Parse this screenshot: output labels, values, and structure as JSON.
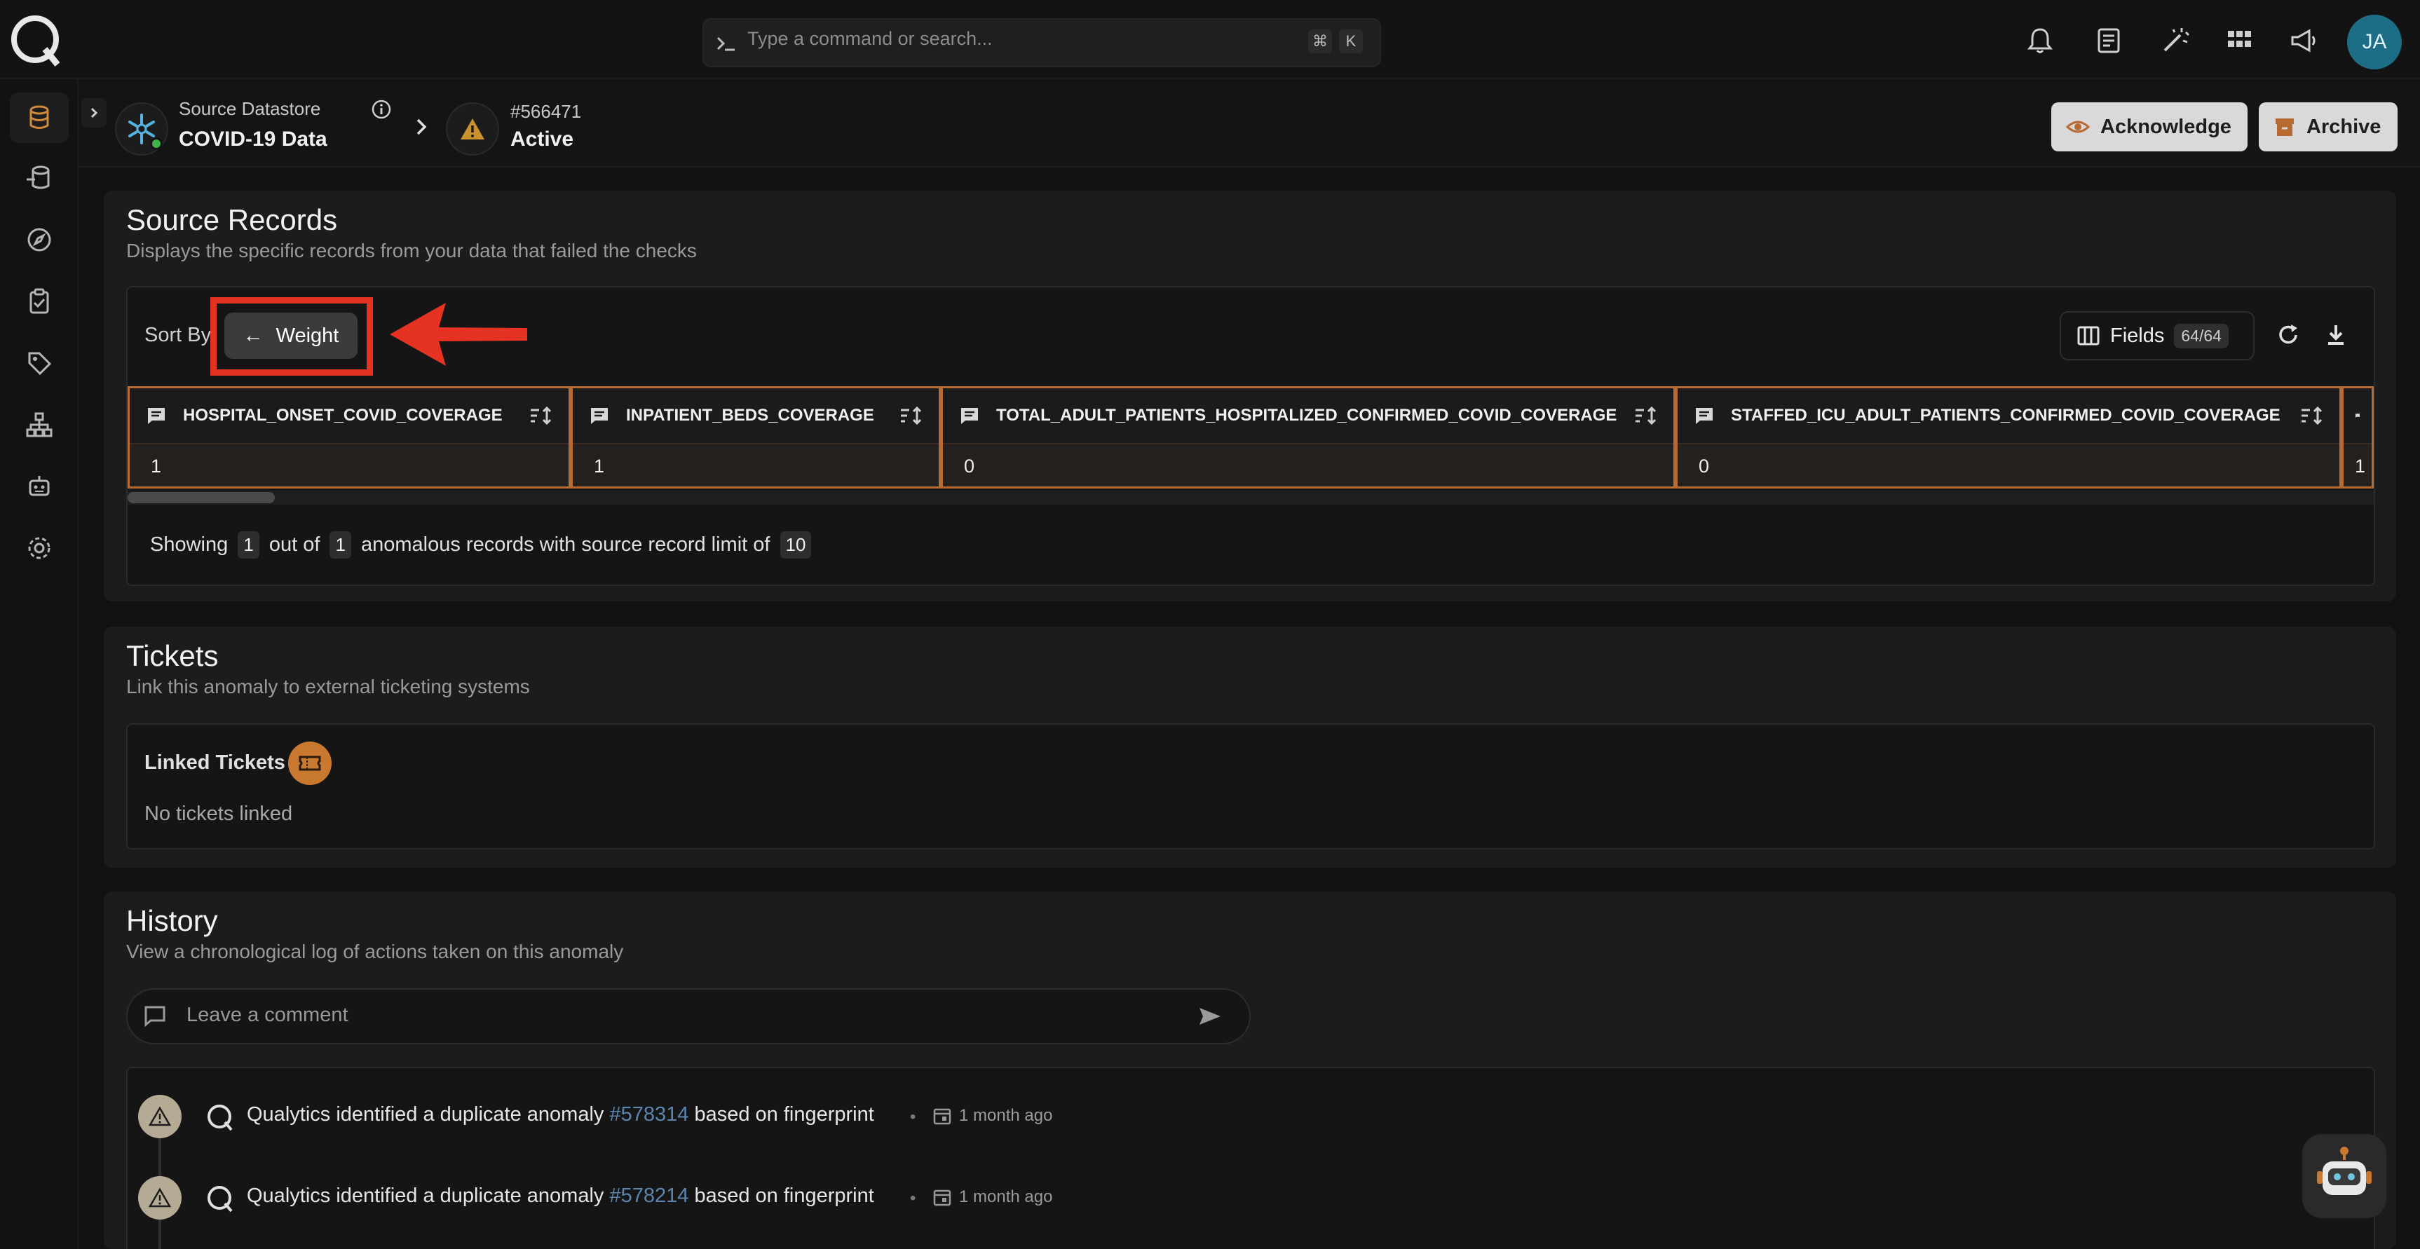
{
  "search": {
    "placeholder": "Type a command or search...",
    "kbd_cmd": "⌘",
    "kbd_key": "K"
  },
  "user": {
    "initials": "JA"
  },
  "breadcrumb": {
    "datastore_label": "Source Datastore",
    "datastore_name": "COVID-19 Data",
    "anomaly_id": "#566471",
    "anomaly_status": "Active"
  },
  "actions": {
    "acknowledge": "Acknowledge",
    "archive": "Archive"
  },
  "source_records": {
    "title": "Source Records",
    "subtitle": "Displays the specific records from your data that failed the checks",
    "sort_label": "Sort By",
    "sort_arrow": "←",
    "sort_value": "Weight",
    "fields_label": "Fields",
    "fields_count": "64/64",
    "columns": [
      {
        "name": "HOSPITAL_ONSET_COVID_COVERAGE",
        "value": "1"
      },
      {
        "name": "INPATIENT_BEDS_COVERAGE",
        "value": "1"
      },
      {
        "name": "TOTAL_ADULT_PATIENTS_HOSPITALIZED_CONFIRMED_COVID_COVERAGE",
        "value": "0"
      },
      {
        "name": "STAFFED_ICU_ADULT_PATIENTS_CONFIRMED_COVID_COVERAGE",
        "value": "0"
      },
      {
        "name": "",
        "value": "1"
      }
    ],
    "showing_prefix": "Showing",
    "showing_count": "1",
    "showing_mid": "out of",
    "showing_total": "1",
    "showing_suffix": "anomalous records with source record limit of",
    "showing_limit": "10"
  },
  "tickets": {
    "title": "Tickets",
    "subtitle": "Link this anomaly to external ticketing systems",
    "linked_label": "Linked Tickets",
    "empty_text": "No tickets linked"
  },
  "history": {
    "title": "History",
    "subtitle": "View a chronological log of actions taken on this anomaly",
    "comment_placeholder": "Leave a comment",
    "entries": [
      {
        "text": "Qualytics identified a duplicate anomaly",
        "link": "#578314",
        "suffix": "based on fingerprint",
        "time": "1 month ago"
      },
      {
        "text": "Qualytics identified a duplicate anomaly",
        "link": "#578214",
        "suffix": "based on fingerprint",
        "time": "1 month ago"
      }
    ]
  },
  "colors": {
    "accent": "#c9782f",
    "highlight": "#e53222",
    "link": "#5b86b0",
    "active_dot": "#3fb24a"
  }
}
